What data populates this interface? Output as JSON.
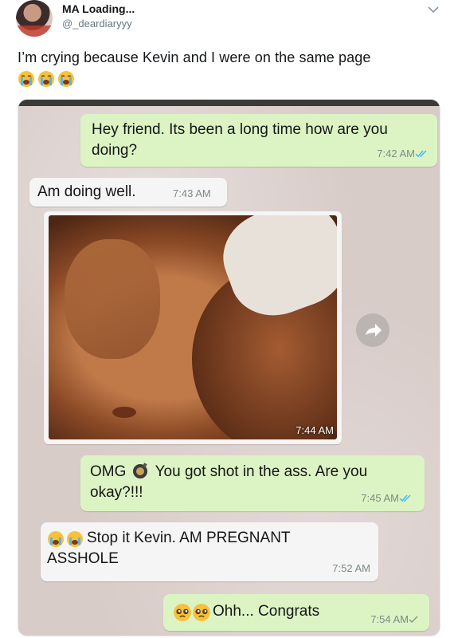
{
  "tweet": {
    "display_name": "MA Loading...",
    "handle": "@_deardiaryyy",
    "text": "I’m crying because Kevin and I were on the same page",
    "emojis": [
      "loudly-crying-face",
      "loudly-crying-face",
      "loudly-crying-face"
    ]
  },
  "chat": {
    "messages": [
      {
        "direction": "out",
        "text": "Hey friend. Its been a long time how are you doing?",
        "time": "7:42 AM",
        "ticks": "double-blue"
      },
      {
        "direction": "in",
        "text": "Am doing well.",
        "time": "7:43 AM"
      },
      {
        "direction": "in",
        "type": "photo",
        "time": "7:44 AM"
      },
      {
        "direction": "out",
        "text_before": "OMG",
        "text_after": "You got shot in the ass. Are you okay?!!!",
        "time": "7:45 AM",
        "ticks": "double-blue"
      },
      {
        "direction": "in",
        "text": "Stop it Kevin. AM PREGNANT ASSHOLE",
        "time": "7:52 AM"
      },
      {
        "direction": "out",
        "text": "Ohh... Congrats",
        "time": "7:54 AM",
        "ticks": "single-grey"
      }
    ]
  },
  "colors": {
    "outgoing": "#dcf4c4",
    "incoming": "#f5f5f5",
    "blue_tick": "#4fb6ec"
  }
}
